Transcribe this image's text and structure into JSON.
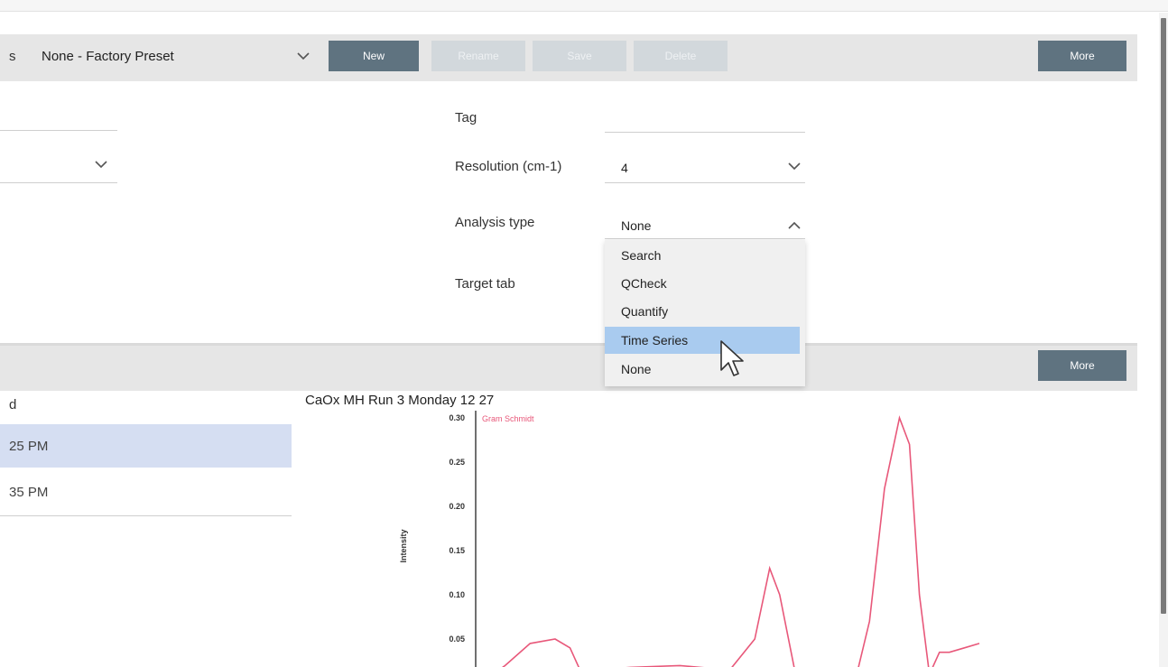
{
  "toolbar": {
    "prefix": "s",
    "preset": "None - Factory Preset",
    "buttons": [
      "New",
      "Rename",
      "Save",
      "Delete"
    ],
    "more_label": "More"
  },
  "form": {
    "tag_label": "Tag",
    "tag_value": "",
    "resolution_label": "Resolution (cm-1)",
    "resolution_value": "4",
    "analysis_label": "Analysis type",
    "analysis_value": "None",
    "target_tab_label": "Target tab"
  },
  "analysis_options": [
    "Search",
    "QCheck",
    "Quantify",
    "Time Series",
    "None"
  ],
  "analysis_highlighted": "Time Series",
  "toolbar2": {
    "more_label": "More"
  },
  "list": {
    "header": "d",
    "rows": [
      "25 PM",
      "35 PM"
    ]
  },
  "chart_data": {
    "type": "line",
    "title": "CaOx MH Run 3 Monday 12 27",
    "ylabel": "Intensity",
    "ylim": [
      0,
      0.3
    ],
    "yticks": [
      "0.30",
      "0.25",
      "0.20",
      "0.15",
      "0.10",
      "0.05"
    ],
    "series": [
      {
        "name": "Gram Schmidt",
        "color": "#e8587a",
        "x": [
          0,
          5,
          10,
          15,
          18,
          20,
          23,
          26,
          30,
          40,
          50,
          55,
          58,
          60,
          63,
          66,
          70,
          72,
          75,
          78,
          81,
          84,
          86,
          88,
          90,
          92,
          94,
          97,
          100
        ],
        "y": [
          0.0,
          0.02,
          0.045,
          0.05,
          0.04,
          0.015,
          0.014,
          0.016,
          0.018,
          0.02,
          0.015,
          0.05,
          0.13,
          0.1,
          0.015,
          0.012,
          0.01,
          0.004,
          0.0,
          0.07,
          0.22,
          0.3,
          0.27,
          0.1,
          0.01,
          0.035,
          0.035,
          0.04,
          0.045
        ]
      }
    ]
  }
}
